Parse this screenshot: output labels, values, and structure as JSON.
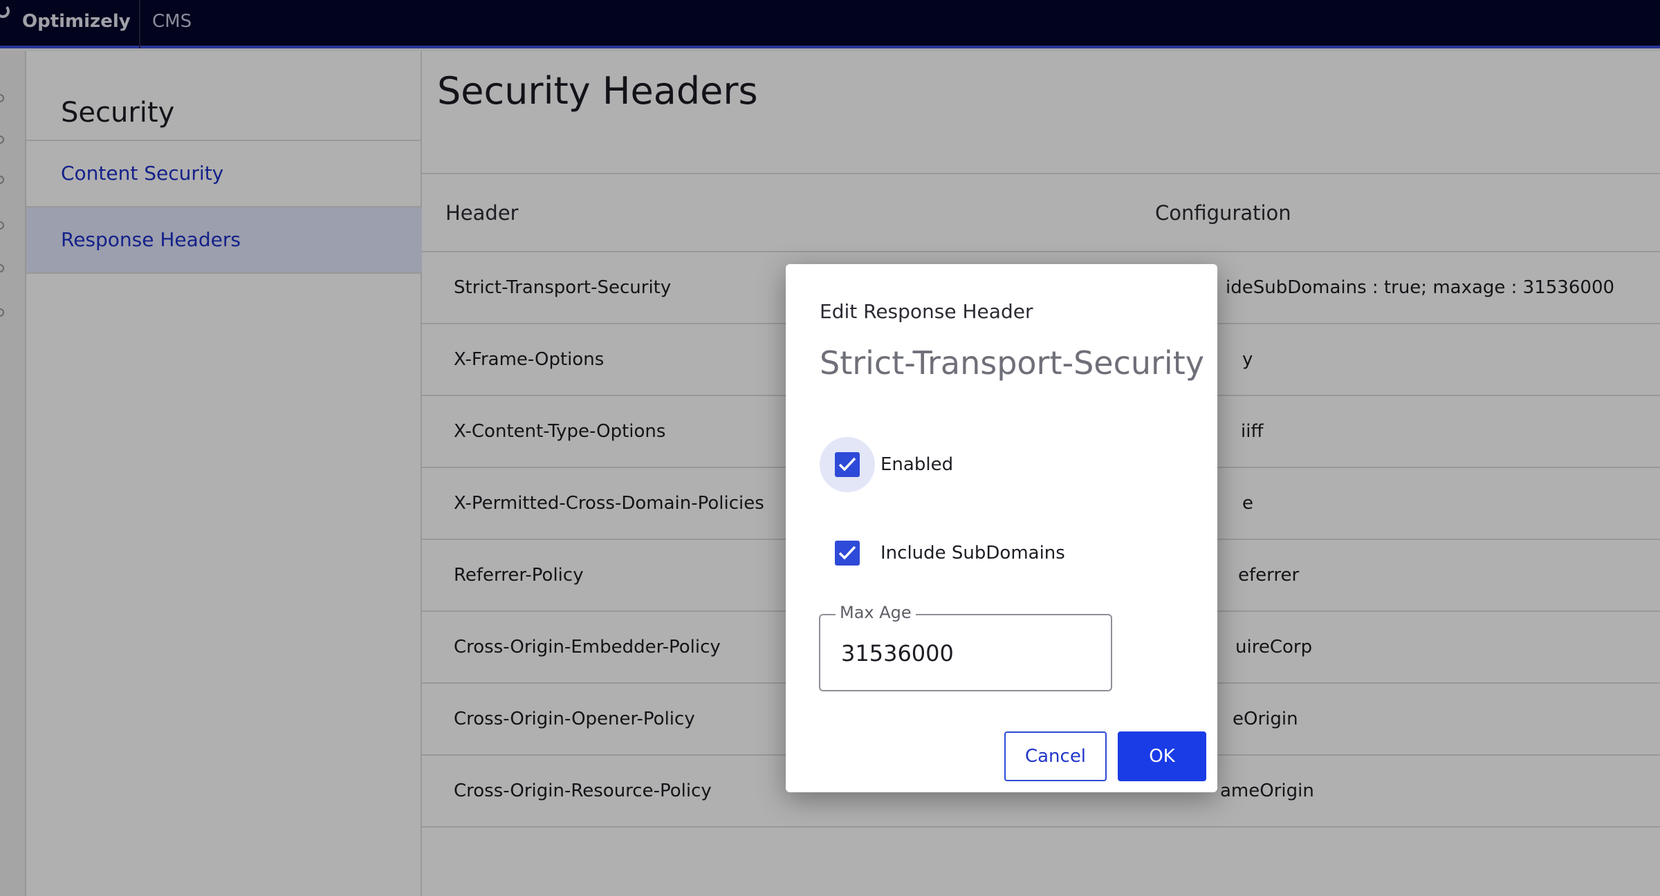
{
  "topbar": {
    "brand": "Optimizely",
    "product": "CMS"
  },
  "sidebar": {
    "title": "Security",
    "items": [
      {
        "label": "Content Security",
        "active": false
      },
      {
        "label": "Response Headers",
        "active": true
      }
    ]
  },
  "main": {
    "title": "Security Headers",
    "columns": [
      "Header",
      "Configuration"
    ],
    "rows": [
      {
        "header": "Strict-Transport-Security",
        "config": "ideSubDomains : true; maxage : 31536000"
      },
      {
        "header": "X-Frame-Options",
        "config": "y"
      },
      {
        "header": "X-Content-Type-Options",
        "config": "iiff"
      },
      {
        "header": "X-Permitted-Cross-Domain-Policies",
        "config": "e"
      },
      {
        "header": "Referrer-Policy",
        "config": "eferrer"
      },
      {
        "header": "Cross-Origin-Embedder-Policy",
        "config": "uireCorp"
      },
      {
        "header": "Cross-Origin-Opener-Policy",
        "config": "eOrigin"
      },
      {
        "header": "Cross-Origin-Resource-Policy",
        "config": "ameOrigin"
      }
    ]
  },
  "dialog": {
    "title": "Edit Response Header",
    "subtitle": "Strict-Transport-Security",
    "enabled": {
      "label": "Enabled",
      "checked": true
    },
    "include_subdomains": {
      "label": "Include SubDomains",
      "checked": true
    },
    "max_age": {
      "label": "Max Age",
      "value": "31536000"
    },
    "cancel_label": "Cancel",
    "ok_label": "OK"
  },
  "colors": {
    "topbar": "#04052a",
    "accent": "#1a3ce6",
    "link": "#1e30c8",
    "active_nav": "#e3e7fb"
  },
  "icons": [
    "optimizely-logo-icon",
    "check-icon"
  ]
}
